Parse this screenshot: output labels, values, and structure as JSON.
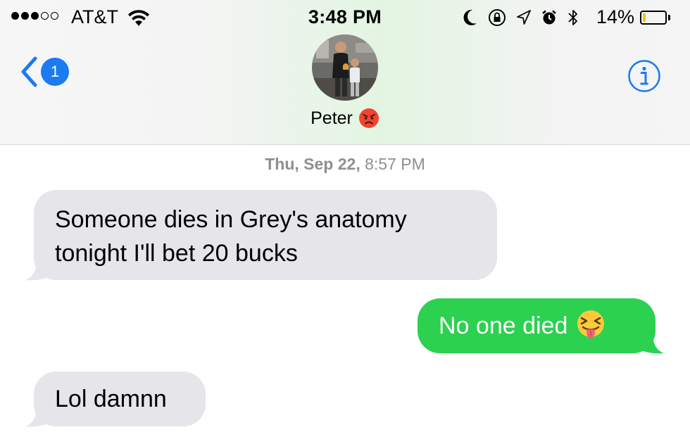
{
  "status_bar": {
    "carrier": "AT&T",
    "time": "3:48 PM",
    "battery_percent": "14%",
    "signal_bars_filled": 3,
    "signal_bars_total": 5,
    "battery_level": 0.14,
    "battery_color": "#f2c200",
    "icons": [
      "wifi-icon",
      "do-not-disturb-moon-icon",
      "rotation-lock-icon",
      "location-arrow-icon",
      "alarm-clock-icon",
      "bluetooth-icon"
    ]
  },
  "header": {
    "back_badge_count": "1",
    "contact_name": "Peter",
    "contact_emoji": "angry-face",
    "info_icon": "info-icon"
  },
  "conversation": {
    "timestamp_day": "Thu, Sep 22,",
    "timestamp_time": " 8:57 PM",
    "messages": [
      {
        "direction": "incoming",
        "line1": "Someone dies in Grey's anatomy",
        "line2": "tonight I'll bet 20 bucks"
      },
      {
        "direction": "outgoing",
        "text": "No one died",
        "emoji": "squinting-face-with-tongue"
      },
      {
        "direction": "incoming",
        "text": "Lol damnn"
      }
    ]
  },
  "colors": {
    "ios_blue": "#1a7bf2",
    "incoming_bubble": "#e5e5ea",
    "outgoing_bubble": "#2bd14f",
    "timestamp_gray": "#8e8e93"
  }
}
